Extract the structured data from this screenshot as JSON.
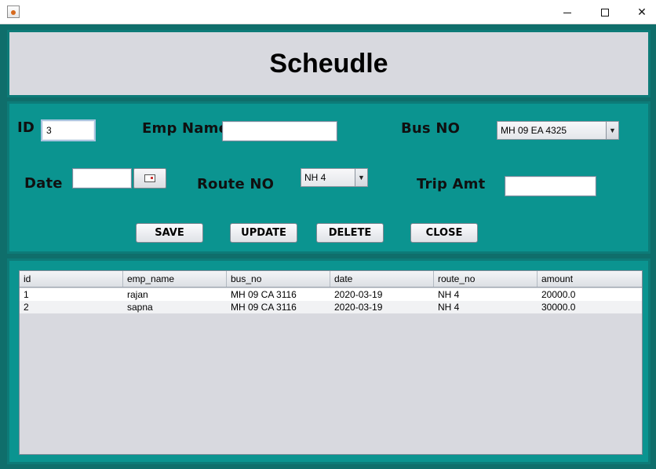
{
  "window": {
    "icon": "java-app-icon",
    "min_symbol": "",
    "max_symbol": "",
    "close_symbol": "✕"
  },
  "header": {
    "title": "Scheudle"
  },
  "form": {
    "id_label": "ID",
    "id_value": "3",
    "emp_name_label": "Emp Name",
    "emp_name_value": "",
    "bus_no_label": "Bus NO",
    "bus_no_selected": "MH 09 EA 4325",
    "date_label": "Date",
    "date_value": "",
    "route_no_label": "Route NO",
    "route_no_selected": "NH 4",
    "trip_amt_label": "Trip Amt",
    "trip_amt_value": ""
  },
  "buttons": {
    "save": "SAVE",
    "update": "UPDATE",
    "delete": "DELETE",
    "close": "CLOSE"
  },
  "table": {
    "columns": [
      "id",
      "emp_name",
      "bus_no",
      "date",
      "route_no",
      "amount"
    ],
    "rows": [
      [
        "1",
        "rajan",
        "MH 09 CA 3116",
        "2020-03-19",
        "NH 4",
        "20000.0"
      ],
      [
        "2",
        "sapna",
        "MH 09 CA 3116",
        "2020-03-19",
        "NH 4",
        "30000.0"
      ]
    ]
  },
  "colors": {
    "frame": "#0f6e6b",
    "panel": "#0b9490",
    "panel_border": "#0d7b78",
    "header_bg": "#d8d9df"
  }
}
